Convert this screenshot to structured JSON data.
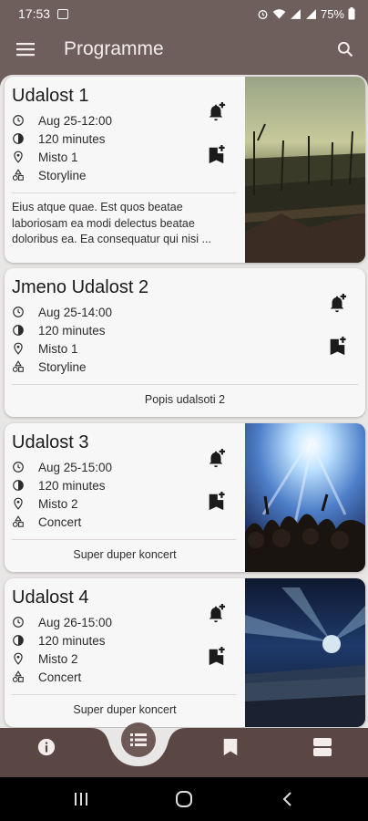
{
  "status_bar": {
    "time": "17:53",
    "battery": "75%"
  },
  "app_bar": {
    "title": "Programme"
  },
  "events": [
    {
      "title": "Udalost 1",
      "datetime": "Aug 25-12:00",
      "duration": "120 minutes",
      "location": "Misto 1",
      "category": "Storyline",
      "description": "Eius atque quae. Est quos beatae laboriosam ea modi delectus beatae doloribus ea. Ea consequatur qui nisi ..."
    },
    {
      "title": "Jmeno Udalost 2",
      "datetime": "Aug 25-14:00",
      "duration": "120 minutes",
      "location": "Misto 1",
      "category": "Storyline",
      "description": "Popis udalsoti 2"
    },
    {
      "title": "Udalost 3",
      "datetime": "Aug 25-15:00",
      "duration": "120 minutes",
      "location": "Misto 2",
      "category": "Concert",
      "description": "Super duper koncert"
    },
    {
      "title": "Udalost 4",
      "datetime": "Aug 26-15:00",
      "duration": "120 minutes",
      "location": "Misto 2",
      "category": "Concert",
      "description": "Super duper koncert"
    }
  ],
  "icons": {
    "app_bar": [
      "menu-icon",
      "search-icon"
    ],
    "info": [
      "clock-icon",
      "timer-icon",
      "location-pin-icon",
      "category-icon"
    ],
    "card_actions": [
      "notification-add-icon",
      "bookmark-add-icon"
    ],
    "bottom_nav": [
      "info-icon",
      "programme-list-icon",
      "bookmark-icon",
      "schedule-icon"
    ]
  },
  "colors": {
    "app_bar": "#6e5f5c",
    "bottom_nav": "#5a4643",
    "background": "#e9e6e6",
    "card": "#f8f7f7"
  }
}
